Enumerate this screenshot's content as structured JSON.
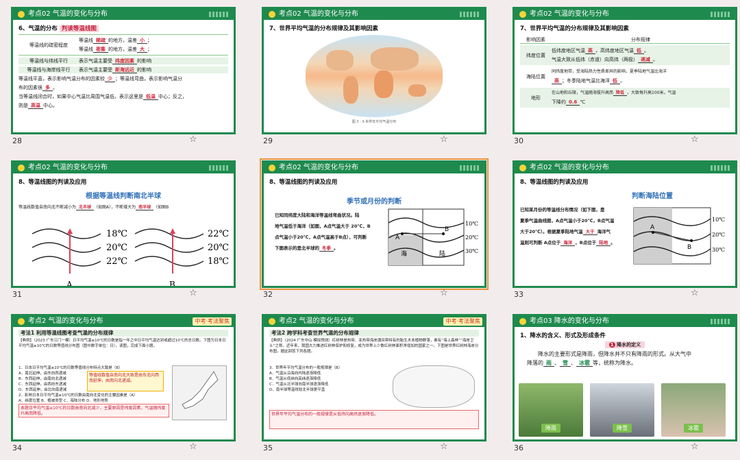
{
  "slides": [
    {
      "num": "28",
      "title": "考点02 气温的变化与分布",
      "heading": "6、气温的分布",
      "badge": "判读等温线图",
      "r1_label": "等温线的疏密程度",
      "r1a": "等温线",
      "r1a_ans": "稀疏",
      "r1a_mid": "的地方，温差",
      "r1a_ans2": "小",
      "r1b": "等温线",
      "r1b_ans": "密集",
      "r1b_mid": "的地方，温差",
      "r1b_ans2": "大",
      "r2_label": "等温线与纬线平行",
      "r2": "表示气温主要受",
      "r2_ans": "纬度因素",
      "r2_end": "的影响",
      "r3_label": "等温线与海岸线平行",
      "r3": "表示气温主要受",
      "r3_ans": "距海远近",
      "r3_end": "的影响",
      "p1": "等温线平直，表示影响气温分布的因素较",
      "p1_ans": "少",
      "p1_mid": "；等温线弯曲，表示影响气温分",
      "p1b": "布的因素很",
      "p1b_ans": "多",
      "p2": "当等温线闭合时，如果中心气温比周围气温低，表示这里是",
      "p2_ans": "低温",
      "p2_end": "中心；反之，",
      "p2b": "则是",
      "p2b_ans": "高温",
      "p2b_end": "中心。"
    },
    {
      "num": "29",
      "title": "考点02 气温的变化与分布",
      "heading": "7、世界平均气温的分布规律及其影响因素",
      "caption": "图 3 - 9 世界年平均气温分布"
    },
    {
      "num": "30",
      "title": "考点02 气温的变化与分布",
      "heading": "7、世界平均气温的分布规律及其影响因素",
      "col1": "影响因素",
      "col2": "分布规律",
      "f1": "纬度位置",
      "f1a": "低纬度地区气温",
      "f1a_ans": "高",
      "f1a_mid": "，高纬度地区气温",
      "f1a_ans2": "低",
      "f1b": "气温大致从低纬（赤道）向高纬（两极）",
      "f1b_ans": "递减",
      "f2": "海陆位置",
      "f2a": "同纬度地带，受海陆热力性质差异的影响，夏季陆地气温比海洋",
      "f2b_ans": "高",
      "f2b": "；冬季陆地气温比海洋",
      "f2b_ans2": "低",
      "f3": "地形",
      "f3a": "在山地和丘陵，气温随海拔升高而",
      "f3a_ans": "降低",
      "f3a_end": "，大致每升高100米，气温",
      "f3b": "下降约",
      "f3b_ans": "0.6",
      "f3b_end": "℃"
    },
    {
      "num": "31",
      "title": "考点02 气温的变化与分布",
      "heading": "8、等温线图的判读及应用",
      "sub": "根据等温线判断南北半球",
      "line": "等温线数值自南向北不断减小为",
      "ans1": "北半球",
      "mid": "（如图A），不断增大为",
      "ans2": "南半球",
      "end": "（如图B",
      "a_vals": [
        "18℃",
        "20℃",
        "22℃"
      ],
      "b_vals": [
        "22℃",
        "20℃",
        "18℃"
      ],
      "la": "A",
      "lb": "B"
    },
    {
      "num": "32",
      "title": "考点02 气温的变化与分布",
      "heading": "8、等温线图的判读及应用",
      "sub": "季节或月份的判断",
      "l1": "已知同纬度大陆和海洋等温线弯曲状况。陆",
      "l2": "地气温低于海洋（如图，A点气温大于 20℃，B",
      "l3": "点气温小于20℃，A点气温高于B点），可判断",
      "l4": "下图表示的是北半球的",
      "l4_ans": "冬季",
      "v": [
        "10℃",
        "20℃",
        "30℃"
      ],
      "sea": "海",
      "land": "陆",
      "pa": "A",
      "pb": "B"
    },
    {
      "num": "33",
      "title": "考点02 气温的变化与分布",
      "heading": "8、等温线图的判读及应用",
      "sub": "判断海陆位置",
      "l1": "已知某月份的等温线分布情况（如下图，是",
      "l2": "夏季气温曲线图，A点气温小于20℃，B点气温",
      "l3": "大于20℃）。根据夏季陆地气温",
      "l3_ans": "大于",
      "l3_end": "海洋气",
      "l4": "温则可判断 A点位于",
      "l4_ans": "海洋",
      "l4_mid": "，B点位于",
      "l4_ans2": "陆地",
      "v": [
        "10℃",
        "20℃",
        "30℃"
      ],
      "pa": "A",
      "pb": "B"
    },
    {
      "num": "34",
      "title": "考点2 气温的变化与分布",
      "tag": "中考·考法聚焦",
      "heading": "考法1 利用等温线图考查气温的分布规律",
      "q": "【典例】（2023 广东江门一模）日平均气温≥10℃的日数是指一年之中日平均气温达到或超过10℃的总日数。下图为日本日平均气温≥10℃的日数等值线分布图（图中数字单位：日），读图，完成下面小题。",
      "q1": "1．日本日平均气温≥10℃的日数等值线分布特点大致是（B）",
      "o1": [
        "A．南北延伸，由东向西递减",
        "B．东西延伸，由南向北递减",
        "C．东西延伸，由西向东递减",
        "D．东西延伸，由北向南递减"
      ],
      "q2": "2．影响日本日平均气温≥10℃的日数由南向北变化的主要因素是（A）",
      "o2": "A．纬度位置 B．植被类型 C．海陆分布 D．地形地势",
      "note": "等值线数值自南向北大致是由东北向西南延伸，由南向北递减。",
      "note2": "本题日平均气温≥10℃的日数由南向北减少，主要原因是纬度因素，气温随纬度升高而降低。"
    },
    {
      "num": "35",
      "title": "考点2 气温的变化与分布",
      "tag": "中考·考法聚焦",
      "heading": "考法2 跨学科考查世界气温的分布规律",
      "q": "【典例】（2024 广东中山 模拟预测）红树林是热带、亚热带海岸潮间带特有的胎生木本植物群落，素有“海上森林”“海岸卫士”之称。近年来，我国大力推进红树林保护和修复，成为世界上少数红树林面积净增加的国家之一。下图是世界红树林海岸分布图。据此回答下列各题。",
      "q1": "3．世界年平均气温分布的一般规律是（B）",
      "o1": [
        "A．气温从沿海向内陆逐渐降低",
        "B．气温从低纬向高纬逐渐降低",
        "C．气温从北半球向南半球逐渐降低",
        "D．南半球等温线较北半球更平直"
      ],
      "note": "世界年平均气温分布的一般规律是从低纬向高纬逐渐降低。"
    },
    {
      "num": "36",
      "title": "考点03 降水的变化与分布",
      "heading": "1、降水的含义、形式及形成条件",
      "badge_n": "1",
      "badge": "降水的定义",
      "p1": "降水的主要形式是降雨，但降水并不只有降雨的形式。从大气中",
      "p2": "降落的",
      "a1": "雨",
      "sep1": "、",
      "a2": "雪",
      "sep2": "、",
      "a3": "冰雹",
      "p2_end": "等，统称为降水。",
      "photos": [
        "降雨",
        "降雪",
        "冰雹"
      ]
    }
  ],
  "colors": {
    "header": "#1e8a4e",
    "answer": "#d0263a",
    "selected": "#e8953c"
  }
}
